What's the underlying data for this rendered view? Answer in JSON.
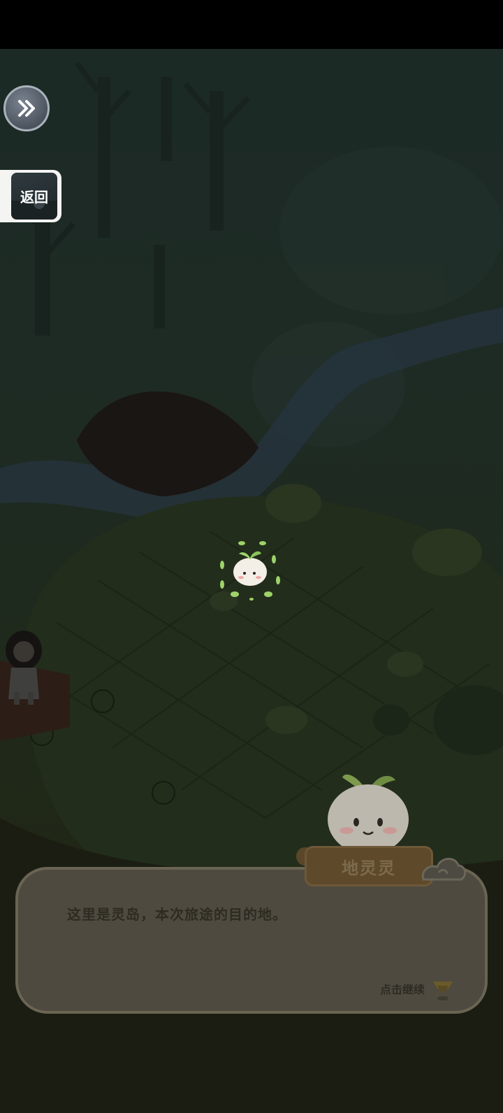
{
  "hud": {
    "skip_icon": "double-chevron-right-icon",
    "back_label": "返回"
  },
  "dialog": {
    "speaker_name": "地灵灵",
    "text": "这里是灵岛，本次旅途的目的地。",
    "continue_hint": "点击继续",
    "continue_icon": "tap-indicator-icon"
  },
  "colors": {
    "overlay_tint": "#1f2a20",
    "dialog_bg": "#4e4a3f",
    "name_plate": "#5e4a2a",
    "sprout_leaf": "#9ed36a"
  }
}
